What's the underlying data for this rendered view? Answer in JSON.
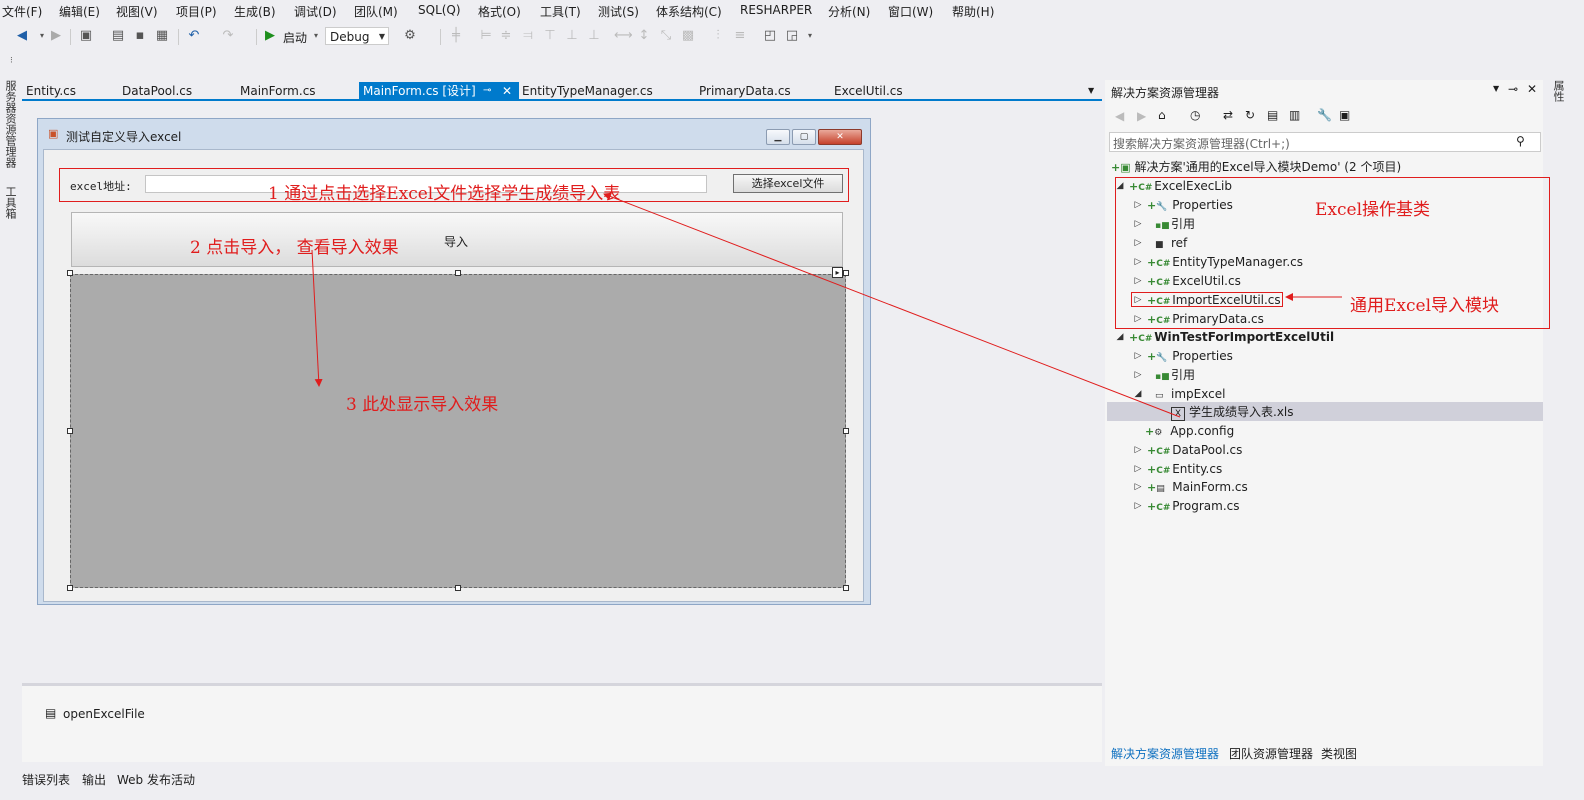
{
  "menu": [
    "文件(F)",
    "编辑(E)",
    "视图(V)",
    "项目(P)",
    "生成(B)",
    "调试(D)",
    "团队(M)",
    "SQL(Q)",
    "格式(O)",
    "工具(T)",
    "测试(S)",
    "体系结构(C)",
    "RESHARPER",
    "分析(N)",
    "窗口(W)",
    "帮助(H)"
  ],
  "toolbar": {
    "start_label": "启动",
    "config_value": "Debug"
  },
  "left_side": {
    "server_explorer": "服务器资源管理器",
    "toolbox": "工具箱"
  },
  "right_side": {
    "properties": "属性"
  },
  "tabs": [
    "Entity.cs",
    "DataPool.cs",
    "MainForm.cs",
    "MainForm.cs [设计]",
    "EntityTypeManager.cs",
    "PrimaryData.cs",
    "ExcelUtil.cs"
  ],
  "form": {
    "title": "测试自定义导入excel",
    "path_label": "excel地址:",
    "path_value": "",
    "choose_button": "选择excel文件",
    "import_button": "导入"
  },
  "annotations": {
    "step1": "1 通过点击选择Excel文件选择学生成绩导入表",
    "step2": "2 点击导入， 查看导入效果",
    "step3": "3 此处显示导入效果",
    "excel_base": "Excel操作基类",
    "import_module": "通用Excel导入模块"
  },
  "tray": {
    "component": "openExcelFile"
  },
  "bottom_tabs": [
    "错误列表",
    "输出",
    "Web 发布活动"
  ],
  "solution_explorer": {
    "title": "解决方案资源管理器",
    "search_placeholder": "搜索解决方案资源管理器(Ctrl+;)",
    "solution": "解决方案'通用的Excel导入模块Demo' (2 个项目)",
    "items": [
      {
        "label": "ExcelExecLib",
        "bold": false
      },
      {
        "label": "Properties"
      },
      {
        "label": "引用"
      },
      {
        "label": "ref"
      },
      {
        "label": "EntityTypeManager.cs"
      },
      {
        "label": "ExcelUtil.cs"
      },
      {
        "label": "ImportExcelUtil.cs"
      },
      {
        "label": "PrimaryData.cs"
      },
      {
        "label": "WinTestForImportExcelUtil",
        "bold": true
      },
      {
        "label": "Properties"
      },
      {
        "label": "引用"
      },
      {
        "label": "impExcel"
      },
      {
        "label": "学生成绩导入表.xls"
      },
      {
        "label": "App.config"
      },
      {
        "label": "DataPool.cs"
      },
      {
        "label": "Entity.cs"
      },
      {
        "label": "MainForm.cs"
      },
      {
        "label": "Program.cs"
      }
    ],
    "bottom_tabs": [
      "解决方案资源管理器",
      "团队资源管理器",
      "类视图"
    ]
  },
  "colors": {
    "accent": "#007acc",
    "annotation": "#e01d1d",
    "grid_area": "#ababab"
  }
}
